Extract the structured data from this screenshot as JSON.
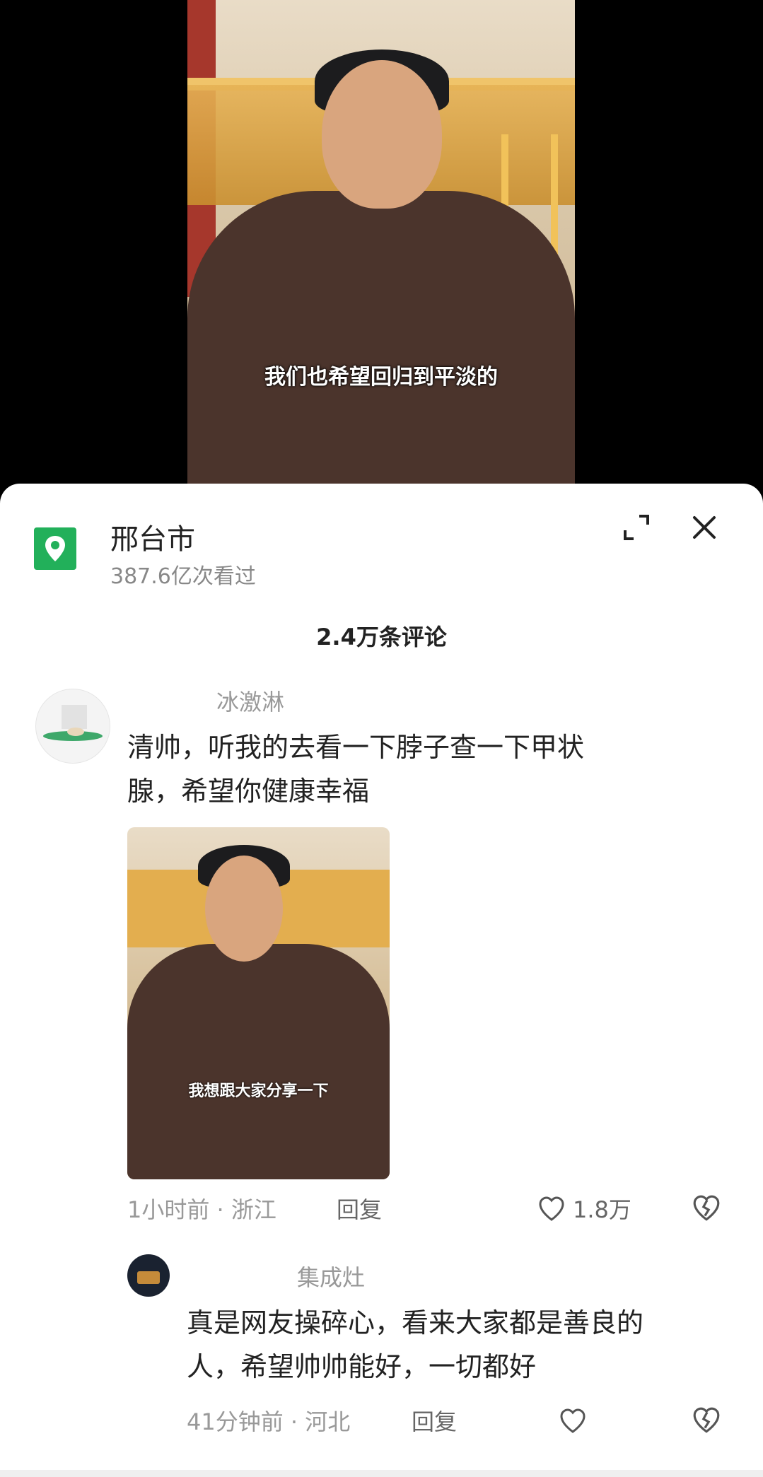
{
  "video": {
    "subtitle": "我们也希望回归到平淡的"
  },
  "sheet": {
    "location_title": "邢台市",
    "view_count": "387.6亿次看过",
    "comment_count": "2.4万条评论"
  },
  "comments": [
    {
      "username": "冰激淋",
      "text_line1": "清帅，听我的去看一下脖子查一下甲状",
      "text_line2": "腺，希望你健康幸福",
      "image_subtitle": "我想跟大家分享一下",
      "time_location": "1小时前 · 浙江",
      "reply_label": "回复",
      "likes": "1.8万"
    },
    {
      "username": "集成灶",
      "text_line1": "真是网友操碎心，看来大家都是善良的",
      "text_line2": "人，希望帅帅能好，一切都好",
      "time_location": "41分钟前 · 河北",
      "reply_label": "回复"
    }
  ],
  "colors": {
    "location_icon": "#22b05a",
    "sheet_bg": "#ffffff",
    "video_bg": "#000000"
  }
}
